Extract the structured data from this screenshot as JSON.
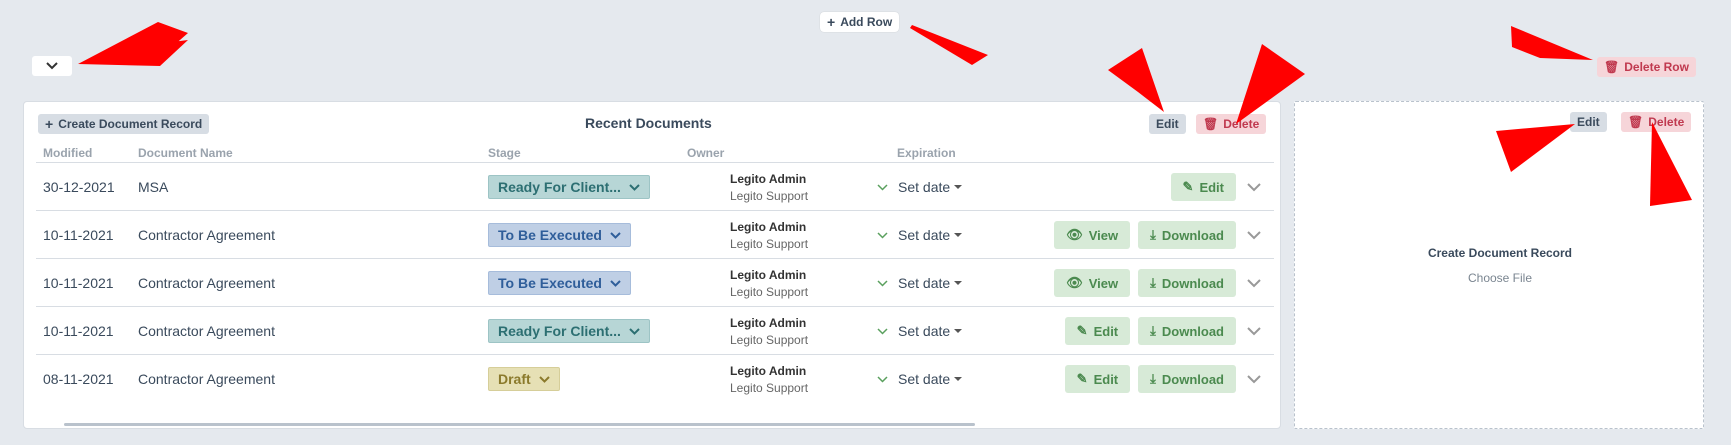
{
  "toolbar": {
    "add_row_label": "Add Row",
    "delete_row_label": "Delete Row"
  },
  "panel": {
    "create_label": "Create Document Record",
    "title": "Recent Documents",
    "edit_label": "Edit",
    "delete_label": "Delete",
    "headers": {
      "modified": "Modified",
      "name": "Document Name",
      "stage": "Stage",
      "owner": "Owner",
      "expiration": "Expiration"
    },
    "rows": [
      {
        "modified": "30-12-2021",
        "name": "MSA",
        "stage": "Ready For Client...",
        "owner1": "Legito Admin",
        "owner2": "Legito Support",
        "expiration": "Set date",
        "actions": [
          "Edit"
        ]
      },
      {
        "modified": "10-11-2021",
        "name": "Contractor Agreement",
        "stage": "To Be Executed",
        "owner1": "Legito Admin",
        "owner2": "Legito Support",
        "expiration": "Set date",
        "actions": [
          "View",
          "Download"
        ]
      },
      {
        "modified": "10-11-2021",
        "name": "Contractor Agreement",
        "stage": "To Be Executed",
        "owner1": "Legito Admin",
        "owner2": "Legito Support",
        "expiration": "Set date",
        "actions": [
          "View",
          "Download"
        ]
      },
      {
        "modified": "10-11-2021",
        "name": "Contractor Agreement",
        "stage": "Ready For Client...",
        "owner1": "Legito Admin",
        "owner2": "Legito Support",
        "expiration": "Set date",
        "actions": [
          "Edit",
          "Download"
        ]
      },
      {
        "modified": "08-11-2021",
        "name": "Contractor Agreement",
        "stage": "Draft",
        "owner1": "Legito Admin",
        "owner2": "Legito Support",
        "expiration": "Set date",
        "actions": [
          "Edit",
          "Download"
        ]
      }
    ]
  },
  "panel2": {
    "edit_label": "Edit",
    "delete_label": "Delete",
    "create_title": "Create Document Record",
    "choose_file": "Choose File"
  },
  "colors": {
    "background": "#e5e9ee",
    "danger": "#c0394f",
    "success": "#4b8a4f",
    "annotation_arrow": "#ff0000"
  }
}
